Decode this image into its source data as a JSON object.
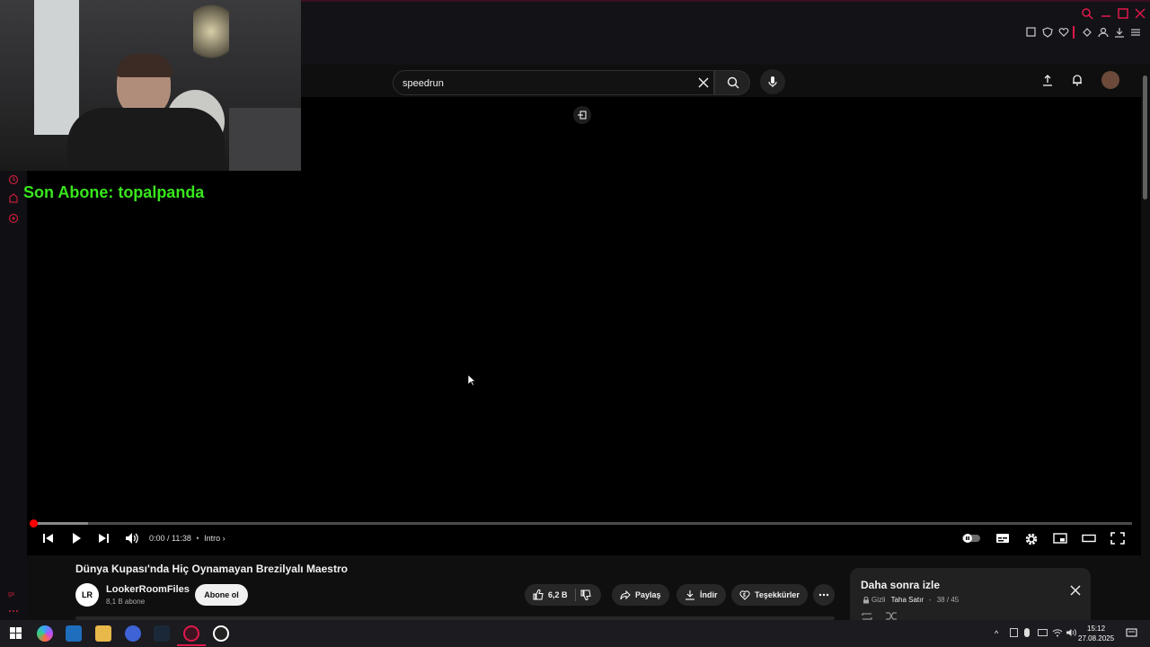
{
  "browser": {
    "toolbar_icons": [
      "snapshot-icon",
      "shield-icon",
      "heart-icon",
      "extensions-icon",
      "account-icon",
      "download-icon",
      "menu-icon"
    ]
  },
  "stream_overlay": {
    "subscriber_text": "Son Abone: topalpanda"
  },
  "youtube": {
    "search": {
      "value": "speedrun"
    },
    "player": {
      "time": "0:00 / 11:38",
      "chapter": "Intro",
      "progress_fraction": 0.0
    },
    "video": {
      "title": "Dünya Kupası'nda Hiç Oynamayan Brezilyalı Maestro",
      "channel_name": "LookerRoomFiles",
      "channel_initials": "LR",
      "subscribers": "8,1 B abone",
      "subscribe_label": "Abone ol",
      "likes": "6,2 B",
      "share_label": "Paylaş",
      "download_label": "İndir",
      "thanks_label": "Teşekkürler"
    },
    "watch_later": {
      "title": "Daha sonra izle",
      "privacy": "Gizli",
      "owner": "Taha Satır",
      "position": "38 / 45"
    }
  },
  "taskbar": {
    "time": "15:12",
    "date": "27.08.2025"
  }
}
